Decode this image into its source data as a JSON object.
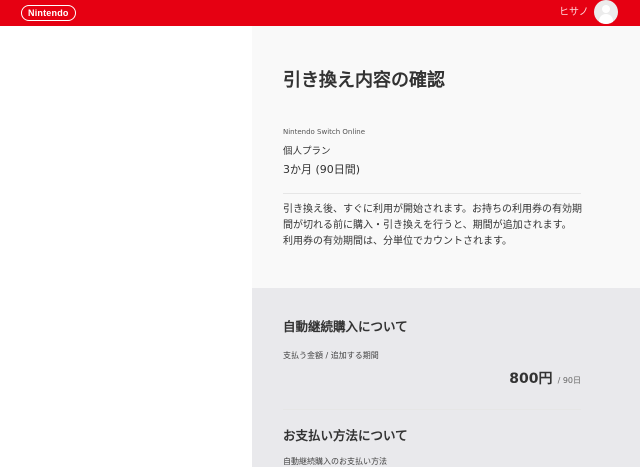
{
  "header": {
    "logo_text": "Nintendo",
    "username": "ヒサノ",
    "brand_color": "#e60012"
  },
  "page": {
    "title": "引き換え内容の確認",
    "service_name": "Nintendo Switch Online",
    "plan_type": "個人プラン",
    "plan_duration": "3か月 (90日間)",
    "description": [
      "引き換え後、すぐに利用が開始されます。お持ちの利用券の有効期間が切れる前に購入・引き換えを行うと、期間が追加されます。",
      "利用券の有効期間は、分単位でカウントされます。"
    ]
  },
  "auto_renewal": {
    "title": "自動継続購入について",
    "amount_label": "支払う金額 / 追加する期間",
    "price": "800円",
    "period": "/ 90日"
  },
  "payment": {
    "title": "お支払い方法について",
    "label": "自動継続購入のお支払い方法"
  }
}
